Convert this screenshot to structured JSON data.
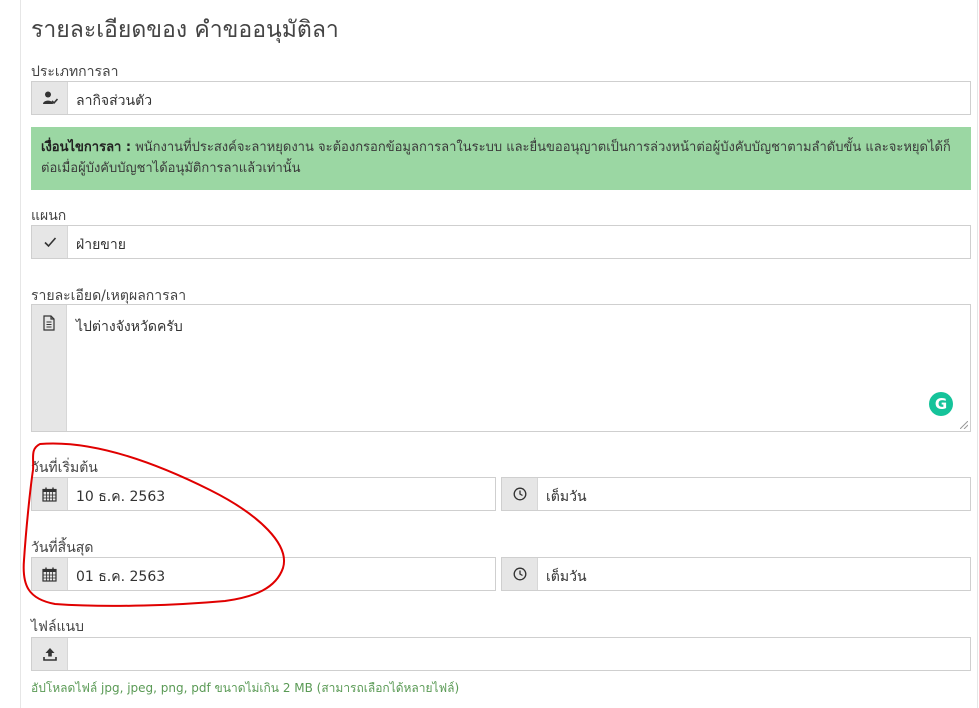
{
  "page_title": "รายละเอียดของ คำขออนุมัติลา",
  "leave_type": {
    "label": "ประเภทการลา",
    "value": "ลากิจส่วนตัว",
    "icon": "user-check-icon"
  },
  "condition": {
    "title": "เงื่อนไขการลา :",
    "text": "พนักงานที่ประสงค์จะลาหยุดงาน จะต้องกรอกข้อมูลการลาในระบบ และยื่นขออนุญาตเป็นการล่วงหน้าต่อผู้บังคับบัญชาตามลำดับขั้น และจะหยุดได้ก็ต่อเมื่อผู้บังคับบัญชาได้อนุมัติการลาแล้วเท่านั้น",
    "bg_color": "#9bd7a3"
  },
  "department": {
    "label": "แผนก",
    "value": "ฝ่ายขาย",
    "icon": "check-icon"
  },
  "reason": {
    "label": "รายละเอียด/เหตุผลการลา",
    "value": "ไปต่างจังหวัดครับ",
    "icon": "document-icon",
    "grammarly_letter": "G"
  },
  "start": {
    "label": "วันที่เริ่มต้น",
    "date": "10 ธ.ค. 2563",
    "time": "เต็มวัน"
  },
  "end": {
    "label": "วันที่สิ้นสุด",
    "date": "01 ธ.ค. 2563",
    "time": "เต็มวัน"
  },
  "attachment": {
    "label": "ไฟล์แนบ",
    "value": "",
    "icon": "upload-icon",
    "hint": "อัปโหลดไฟล์ jpg, jpeg, png, pdf ขนาดไม่เกิน 2 MB (สามารถเลือกได้หลายไฟล์)"
  },
  "annotation_color": "#e00000"
}
